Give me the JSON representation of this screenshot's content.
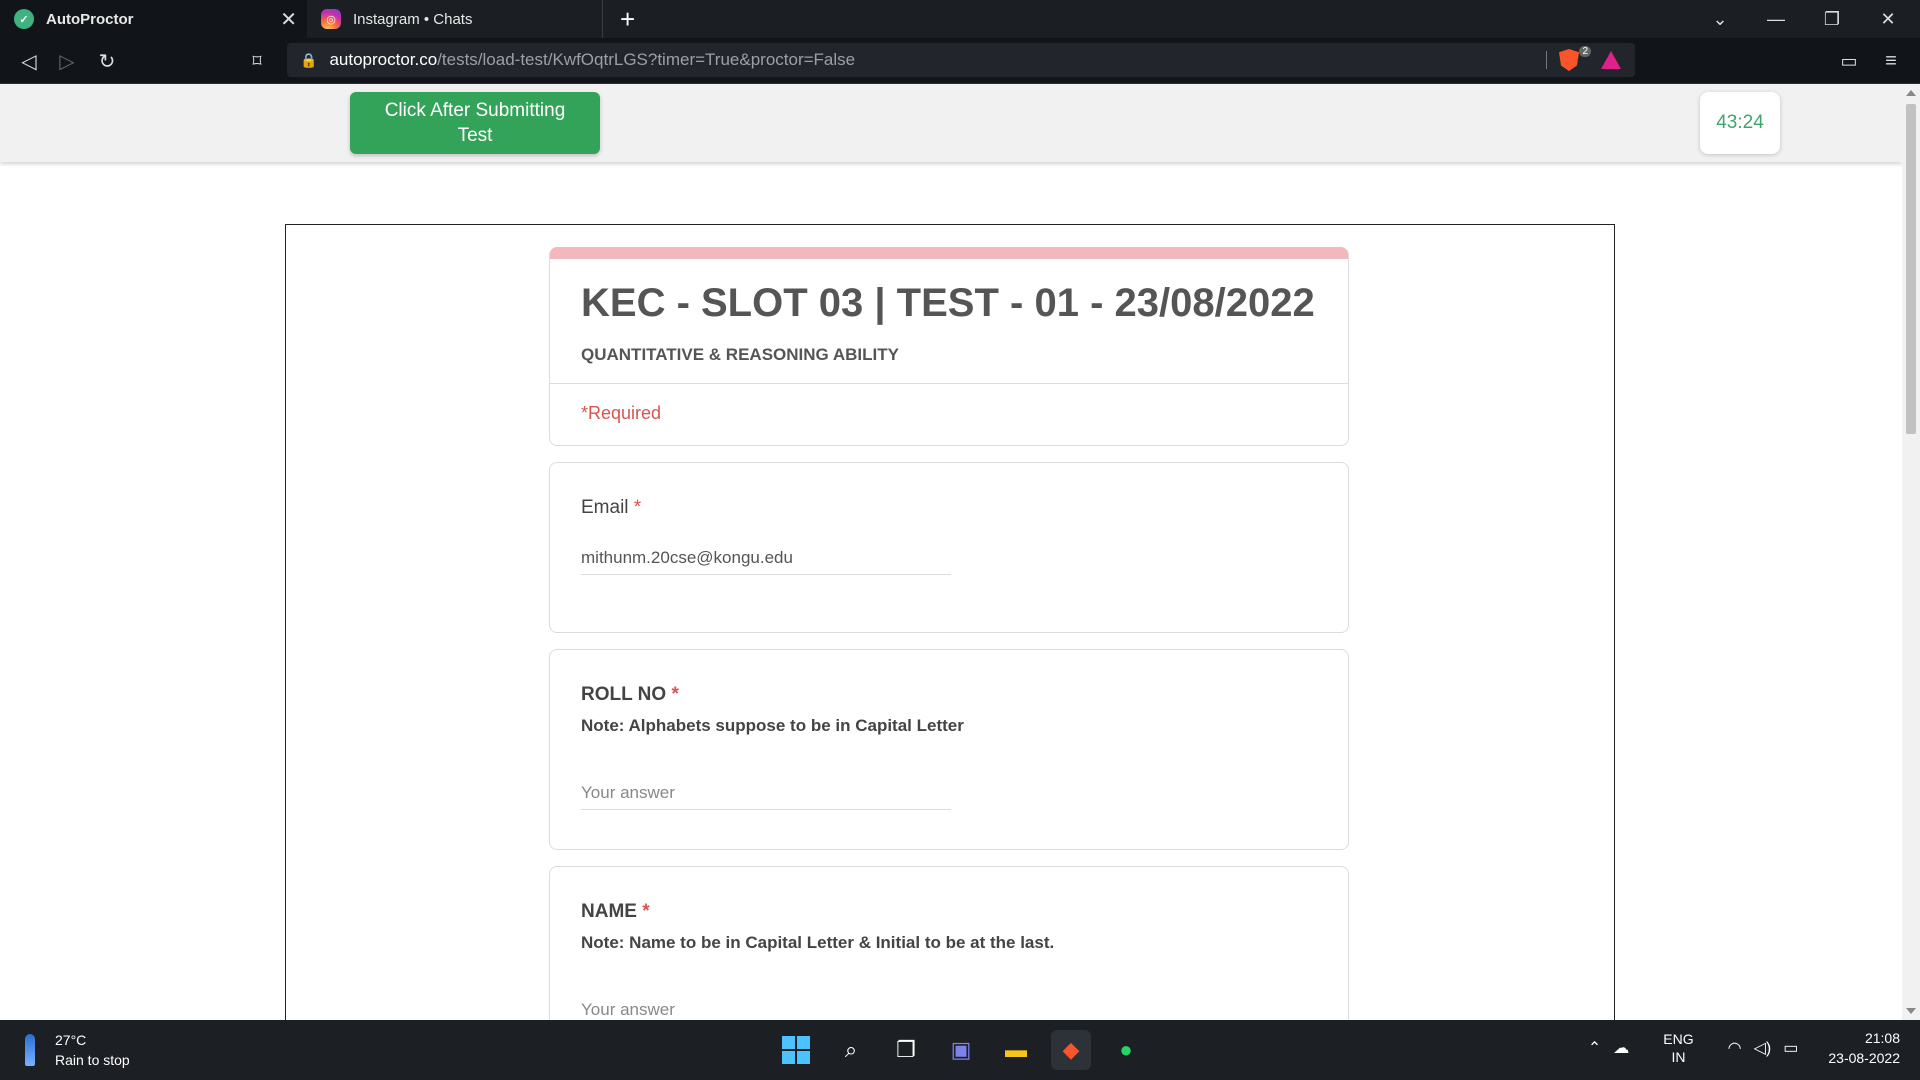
{
  "browser": {
    "tabs": [
      {
        "title": "AutoProctor",
        "active": true
      },
      {
        "title": "Instagram • Chats",
        "active": false
      }
    ],
    "url_host": "autoproctor.co",
    "url_path": "/tests/load-test/KwfOqtrLGS?timer=True&proctor=False",
    "shield_count": "2"
  },
  "proctor": {
    "submit_label": "Click After Submitting Test",
    "timer": "43:24"
  },
  "form": {
    "title": "KEC - SLOT 03 | TEST - 01 - 23/08/2022",
    "subtitle": "QUANTITATIVE & REASONING ABILITY",
    "required_note": "*Required",
    "questions": [
      {
        "label": "Email",
        "required_mark": "*",
        "note": "",
        "value": "mithunm.20cse@kongu.edu",
        "placeholder": "Your answer"
      },
      {
        "label": "ROLL NO",
        "required_mark": "*",
        "note": "Note: Alphabets suppose to be in Capital Letter",
        "value": "",
        "placeholder": "Your answer"
      },
      {
        "label": "NAME",
        "required_mark": "*",
        "note": "Note: Name to be in Capital Letter & Initial to be at the last.",
        "value": "",
        "placeholder": "Your answer"
      }
    ]
  },
  "taskbar": {
    "weather_temp": "27°C",
    "weather_desc": "Rain to stop",
    "lang_top": "ENG",
    "lang_bottom": "IN",
    "time": "21:08",
    "date": "23-08-2022"
  },
  "colors": {
    "accent_green": "#34a35a",
    "form_accent": "#f2b8bb",
    "required_red": "#d9534f"
  }
}
